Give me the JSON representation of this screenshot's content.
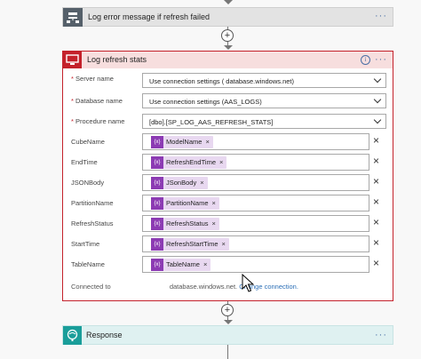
{
  "top_card": {
    "title": "Log error message if refresh failed"
  },
  "main_card": {
    "title": "Log refresh stats",
    "fields": [
      {
        "label": "Server name",
        "required": true,
        "value": "Use connection settings (                    database.windows.net)"
      },
      {
        "label": "Database name",
        "required": true,
        "value": "Use connection settings (AAS_LOGS)"
      },
      {
        "label": "Procedure name",
        "required": true,
        "value": "[dbo].[SP_LOG_AAS_REFRESH_STATS]"
      }
    ],
    "params": [
      {
        "label": "CubeName",
        "token": "ModelName"
      },
      {
        "label": "EndTime",
        "token": "RefreshEndTime"
      },
      {
        "label": "JSONBody",
        "token": "JSonBody"
      },
      {
        "label": "PartitionName",
        "token": "PartitionName"
      },
      {
        "label": "RefreshStatus",
        "token": "RefreshStatus"
      },
      {
        "label": "StartTime",
        "token": "RefreshStartTime"
      },
      {
        "label": "TableName",
        "token": "TableName"
      }
    ],
    "token_badge": "{x}",
    "remove_glyph": "×",
    "connection_prefix": "Connected to",
    "connection_server": "database.windows.net.",
    "change_connection": "Change connection."
  },
  "bottom_card": {
    "title": "Response"
  },
  "add_glyph": "+",
  "more_glyph": "···",
  "info_glyph": "i",
  "colors": {
    "error_accent": "#c4212b",
    "token_badge": "#8c3bb3",
    "response_teal": "#1a9e9a",
    "link": "#2c6fb7"
  }
}
